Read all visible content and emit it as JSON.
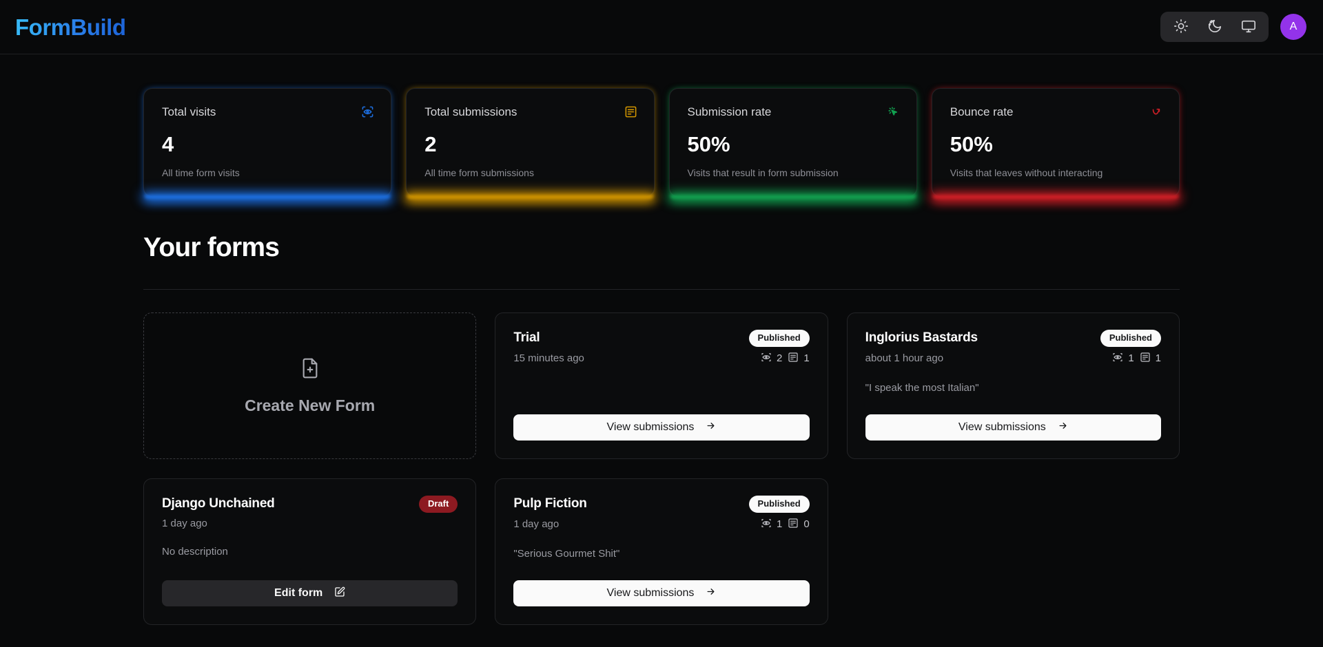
{
  "header": {
    "logo": "FormBuild",
    "theme_buttons": [
      {
        "name": "sun-icon",
        "label": "Light theme"
      },
      {
        "name": "moon-icon",
        "label": "Dark theme"
      },
      {
        "name": "monitor-icon",
        "label": "System theme"
      }
    ],
    "avatar_initial": "A"
  },
  "stats": [
    {
      "title": "Total visits",
      "value": "4",
      "subtitle": "All time form visits",
      "icon": "eye-scan-icon",
      "accent": "#1d6fe0",
      "accent_name": "blue"
    },
    {
      "title": "Total submissions",
      "value": "2",
      "subtitle": "All time form submissions",
      "icon": "form-input-icon",
      "accent": "#d19500",
      "accent_name": "amber"
    },
    {
      "title": "Submission rate",
      "value": "50%",
      "subtitle": "Visits that result in form submission",
      "icon": "mouse-pointer-click-icon",
      "accent": "#12a150",
      "accent_name": "green"
    },
    {
      "title": "Bounce rate",
      "value": "50%",
      "subtitle": "Visits that leaves without interacting",
      "icon": "trending-arrow-icon",
      "accent": "#cf1f26",
      "accent_name": "red"
    }
  ],
  "forms_section": {
    "heading": "Your forms",
    "create_card": {
      "label": "Create New Form",
      "icon": "file-plus-icon"
    },
    "cards": [
      {
        "title": "Trial",
        "badge": "Published",
        "badge_type": "published",
        "date": "15 minutes ago",
        "visits": "2",
        "submissions": "1",
        "description": "",
        "action": "View submissions",
        "action_type": "light"
      },
      {
        "title": "Inglorius Bastards",
        "badge": "Published",
        "badge_type": "published",
        "date": "about 1 hour ago",
        "visits": "1",
        "submissions": "1",
        "description": "\"I speak the most Italian\"",
        "action": "View submissions",
        "action_type": "light"
      },
      {
        "title": "Django Unchained",
        "badge": "Draft",
        "badge_type": "draft",
        "date": "1 day ago",
        "visits": "",
        "submissions": "",
        "description": "No description",
        "action": "Edit form",
        "action_type": "dark"
      },
      {
        "title": "Pulp Fiction",
        "badge": "Published",
        "badge_type": "published",
        "date": "1 day ago",
        "visits": "1",
        "submissions": "0",
        "description": "\"Serious Gourmet Shit\"",
        "action": "View submissions",
        "action_type": "light"
      }
    ]
  }
}
